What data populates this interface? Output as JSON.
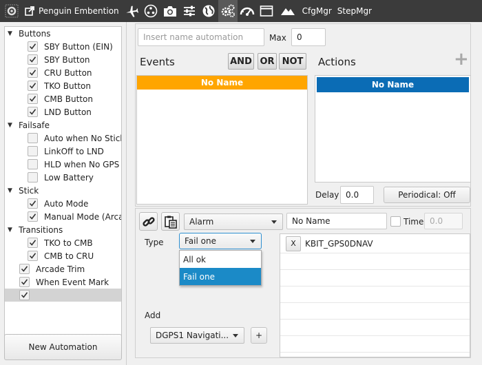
{
  "toolbar": {
    "app_title": "Penguin Embention",
    "items": [
      {
        "name": "settings-gear-icon"
      },
      {
        "name": "open-external-icon"
      },
      {
        "name": "airplane-icon"
      },
      {
        "name": "network-icon"
      },
      {
        "name": "camera-icon"
      },
      {
        "name": "sliders-icon"
      },
      {
        "name": "globe-icon"
      },
      {
        "name": "gears-icon",
        "active": true
      },
      {
        "name": "speedometer-icon"
      },
      {
        "name": "window-icon"
      },
      {
        "name": "mountains-icon"
      }
    ],
    "cfgmgr_label": "CfgMgr",
    "stepmgr_label": "StepMgr"
  },
  "tree": {
    "groups": [
      {
        "label": "Buttons",
        "items": [
          {
            "label": "SBY Button (EIN)",
            "checked": true
          },
          {
            "label": "SBY Button",
            "checked": true
          },
          {
            "label": "CRU Button",
            "checked": true
          },
          {
            "label": "TKO Button",
            "checked": true
          },
          {
            "label": "CMB Button",
            "checked": true
          },
          {
            "label": "LND Button",
            "checked": true
          }
        ]
      },
      {
        "label": "Failsafe",
        "items": [
          {
            "label": "Auto when No Stick",
            "checked": false
          },
          {
            "label": "LinkOff to LND",
            "checked": false
          },
          {
            "label": "HLD when No GPS",
            "checked": false
          },
          {
            "label": "Low Battery",
            "checked": false
          }
        ]
      },
      {
        "label": "Stick",
        "items": [
          {
            "label": "Auto Mode",
            "checked": true
          },
          {
            "label": "Manual Mode (Arcade)",
            "checked": true
          }
        ]
      },
      {
        "label": "Transitions",
        "items": [
          {
            "label": "TKO to CMB",
            "checked": true
          },
          {
            "label": "CMB to CRU",
            "checked": true
          }
        ]
      }
    ],
    "root_items": [
      {
        "label": "Arcade Trim",
        "checked": true
      },
      {
        "label": "When Event Mark",
        "checked": true
      },
      {
        "label": "",
        "checked": true,
        "selected": true
      }
    ]
  },
  "new_automation_label": "New Automation",
  "automation": {
    "name_placeholder": "Insert name automation",
    "max_label": "Max",
    "max_value": "0"
  },
  "events": {
    "title": "Events",
    "and_label": "AND",
    "or_label": "OR",
    "not_label": "NOT",
    "header": "No Name",
    "header_color": "#FFA500"
  },
  "actions": {
    "title": "Actions",
    "header": "No Name",
    "header_color": "#0B6CB5"
  },
  "delay": {
    "label": "Delay",
    "value": "0.0"
  },
  "periodical_label": "Periodical: Off",
  "event_config": {
    "event_type": "Alarm",
    "name_value": "No Name",
    "time_label": "Time",
    "time_value": "0.0",
    "type_label": "Type",
    "type_selected": "Fail one",
    "type_options": [
      "All ok",
      "Fail one"
    ],
    "add_label": "Add",
    "add_selected": "DGPS1 Navigati...",
    "add_button": "+",
    "alarms": [
      {
        "remove": "X",
        "name": "KBIT_GPS0DNAV"
      }
    ]
  }
}
